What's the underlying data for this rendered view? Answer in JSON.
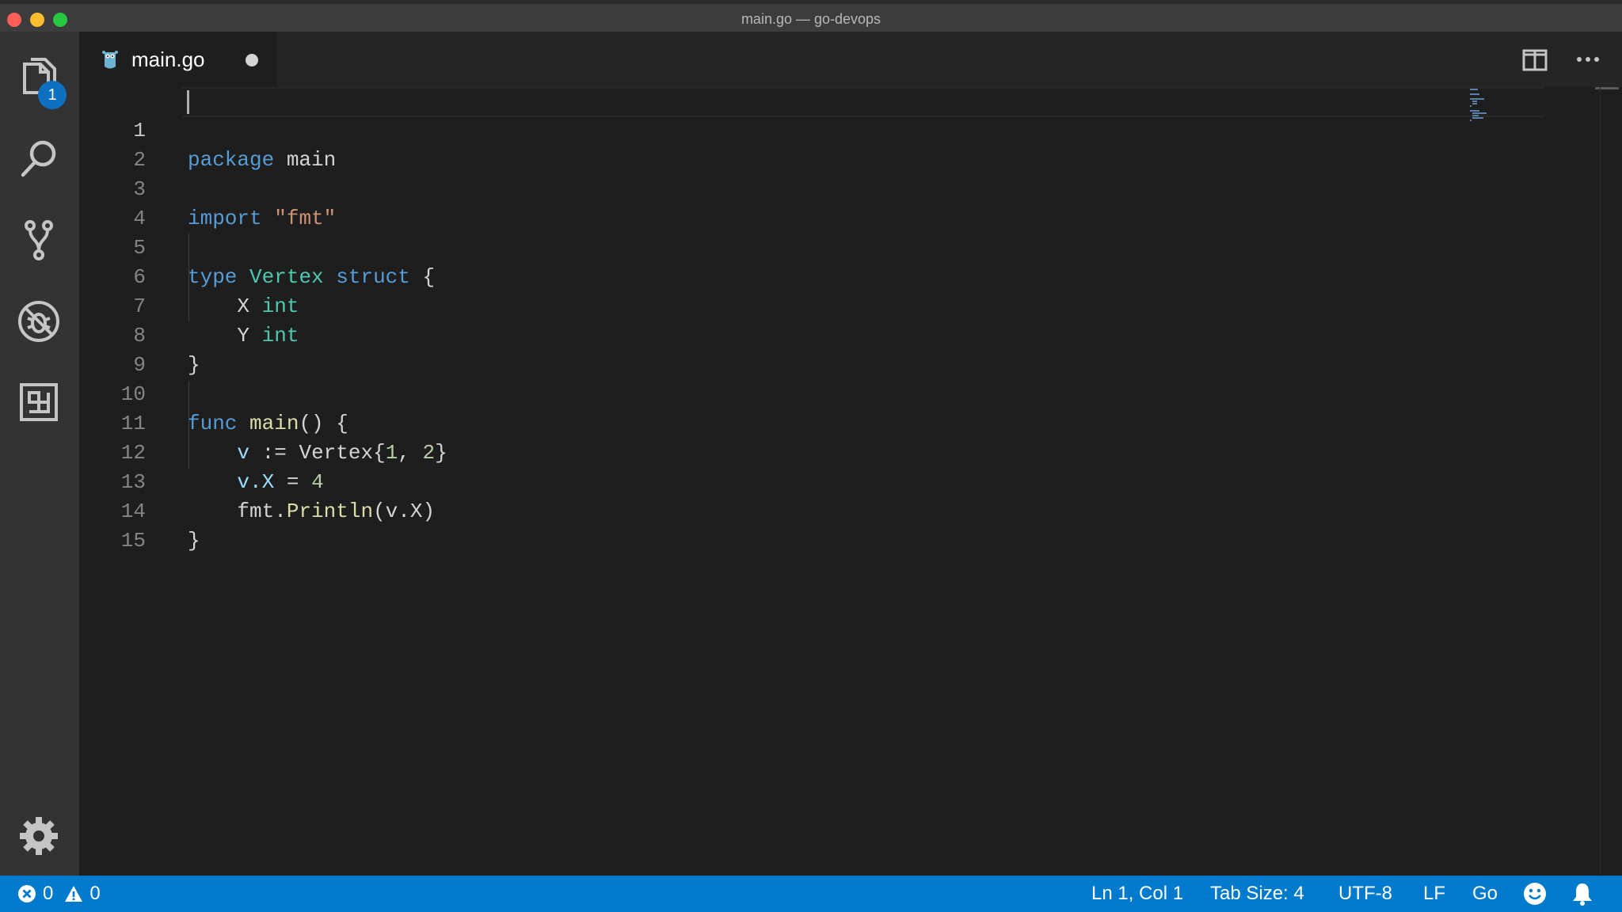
{
  "window": {
    "title": "main.go — go-devops"
  },
  "activity_bar": {
    "explorer_badge": "1"
  },
  "tabs": [
    {
      "label": "main.go",
      "dirty": true
    }
  ],
  "editor": {
    "line_numbers": [
      "1",
      "2",
      "3",
      "4",
      "5",
      "6",
      "7",
      "8",
      "9",
      "10",
      "11",
      "12",
      "13",
      "14",
      "15"
    ],
    "active_line": 1
  },
  "status_bar": {
    "errors": "0",
    "warnings": "0",
    "position": "Ln 1, Col 1",
    "tab_size": "Tab Size: 4",
    "encoding": "UTF-8",
    "eol": "LF",
    "language": "Go"
  },
  "code_tokens": {
    "l1_kw": "package",
    "l1_name": "main",
    "l3_kw": "import",
    "l3_str": "\"fmt\"",
    "l5_kw": "type",
    "l5_type": "Vertex",
    "l5_kw2": "struct",
    "l5_brace": "{",
    "l6_field": "X",
    "l6_type": "int",
    "l7_field": "Y",
    "l7_type": "int",
    "l8_brace": "}",
    "l10_kw": "func",
    "l10_fn": "main",
    "l10_rest": "() {",
    "l11_var": "v",
    "l11_op": ":=",
    "l11_ctor": "Vertex{",
    "l11_n1": "1",
    "l11_comma": ", ",
    "l11_n2": "2",
    "l11_close": "}",
    "l12_obj": "v.",
    "l12_field": "X",
    "l12_op": " = ",
    "l12_num": "4",
    "l13_pkg": "fmt.",
    "l13_fn": "Println",
    "l13_args": "(v.X)",
    "l14_brace": "}"
  },
  "colors": {
    "accent": "#007acc",
    "keyword": "#569cd6",
    "type": "#4ec9b0",
    "string": "#ce9178",
    "number": "#b5cea8",
    "function": "#dcdcaa"
  }
}
